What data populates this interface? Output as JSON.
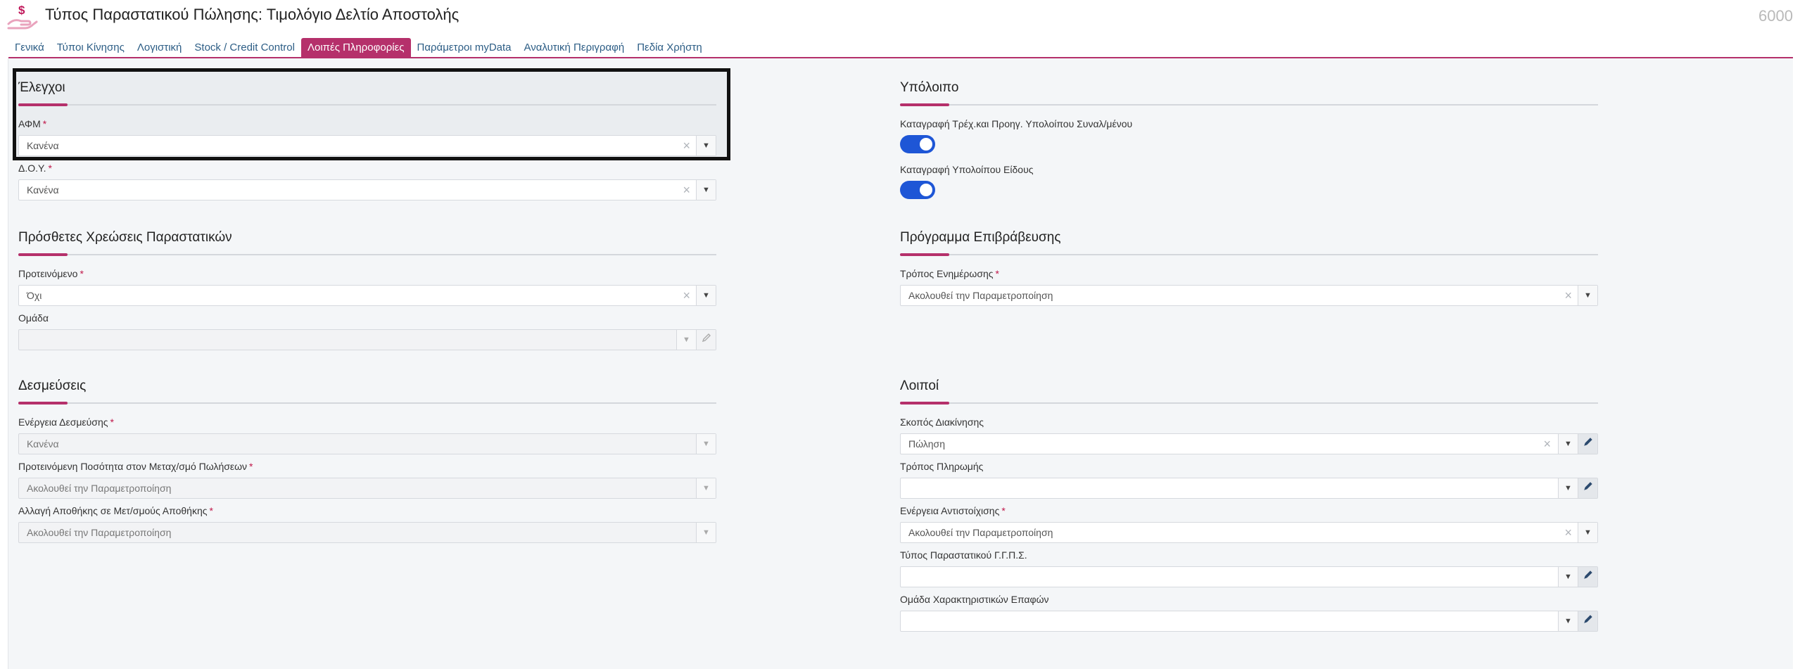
{
  "header": {
    "title": "Τύπος Παραστατικού Πώλησης: Τιμολόγιο Δελτίο Αποστολής",
    "record_id": "6000",
    "logo_icon": "hand-money-icon"
  },
  "tabs": [
    {
      "label": "Γενικά"
    },
    {
      "label": "Τύποι Κίνησης"
    },
    {
      "label": "Λογιστική"
    },
    {
      "label": "Stock / Credit Control"
    },
    {
      "label": "Λοιπές Πληροφορίες",
      "active": true
    },
    {
      "label": "Παράμετροι myData"
    },
    {
      "label": "Αναλυτική Περιγραφή"
    },
    {
      "label": "Πεδία Χρήστη"
    }
  ],
  "left": {
    "checks": {
      "title": "Έλεγχοι",
      "afm": {
        "label": "ΑΦΜ",
        "required": "*",
        "value": "Κανένα"
      },
      "doy": {
        "label": "Δ.Ο.Υ.",
        "required": "*",
        "value": "Κανένα"
      }
    },
    "extra_charges": {
      "title": "Πρόσθετες Χρεώσεις Παραστατικών",
      "suggested": {
        "label": "Προτεινόμενο",
        "required": "*",
        "value": "Όχι"
      },
      "group": {
        "label": "Ομάδα",
        "value": ""
      }
    },
    "commitments": {
      "title": "Δεσμεύσεις",
      "action": {
        "label": "Ενέργεια Δεσμεύσης",
        "required": "*",
        "value": "Κανένα"
      },
      "suggested_qty": {
        "label": "Προτεινόμενη Ποσότητα στον Μεταχ/σμό Πωλήσεων",
        "required": "*",
        "value": "Ακολουθεί την Παραμετροποίηση"
      },
      "warehouse_change": {
        "label": "Αλλαγή Αποθήκης σε Μετ/σμούς Αποθήκης",
        "required": "*",
        "value": "Ακολουθεί την Παραμετροποίηση"
      }
    }
  },
  "right": {
    "balance": {
      "title": "Υπόλοιπο",
      "current_prev": {
        "label": "Καταγραφή Τρέχ.και Προηγ. Υπολοίπου Συναλ/μένου",
        "on": true
      },
      "item_balance": {
        "label": "Καταγραφή Υπολοίπου Είδους",
        "on": true
      }
    },
    "reward": {
      "title": "Πρόγραμμα Επιβράβευσης",
      "update_mode": {
        "label": "Τρόπος Ενημέρωσης",
        "required": "*",
        "value": "Ακολουθεί την Παραμετροποίηση"
      }
    },
    "other": {
      "title": "Λοιποί",
      "purpose": {
        "label": "Σκοπός Διακίνησης",
        "value": "Πώληση"
      },
      "payment": {
        "label": "Τρόπος Πληρωμής",
        "value": ""
      },
      "matching": {
        "label": "Ενέργεια Αντιστοίχισης",
        "required": "*",
        "value": "Ακολουθεί την Παραμετροποίηση"
      },
      "ggps_type": {
        "label": "Τύπος Παραστατικού Γ.Γ.Π.Σ.",
        "value": ""
      },
      "contact_group": {
        "label": "Ομάδα Χαρακτηριστικών Επαφών",
        "value": ""
      }
    }
  },
  "colors": {
    "accent": "#b5306b",
    "toggle_on": "#1e56d6",
    "link": "#2c5d85"
  },
  "icons": {
    "clear": "×",
    "dropdown": "▼",
    "edit": "pencil-icon"
  }
}
